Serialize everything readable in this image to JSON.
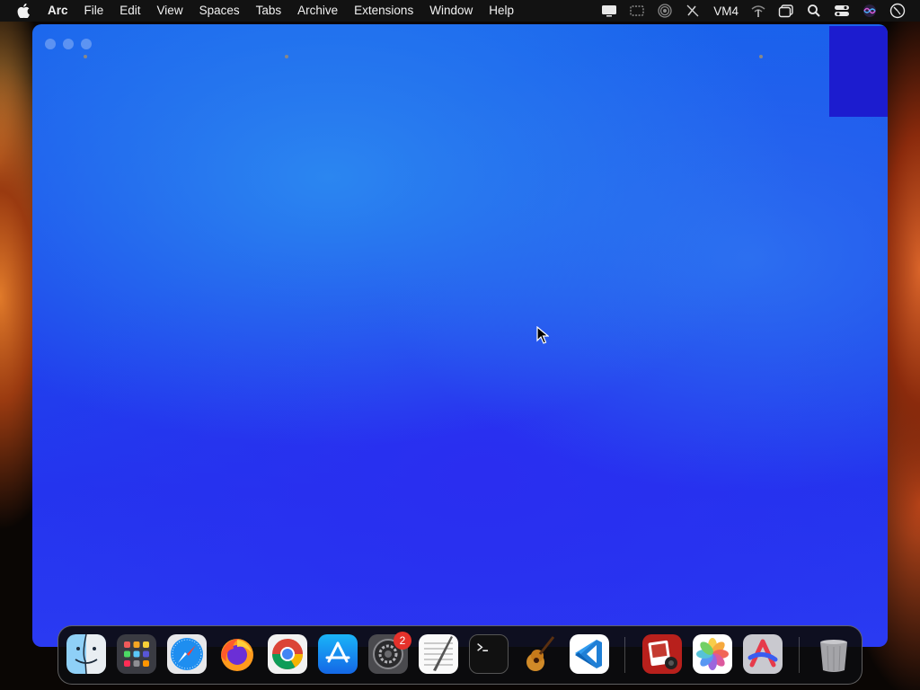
{
  "menubar": {
    "apple_icon": "apple-logo-icon",
    "app_name": "Arc",
    "items": [
      "File",
      "Edit",
      "View",
      "Spaces",
      "Tabs",
      "Archive",
      "Extensions",
      "Window",
      "Help"
    ],
    "status": {
      "display_icon": "display-icon",
      "screen_icon": "screen-mirroring-icon",
      "airdrop_icon": "broadcast-icon",
      "pen_icon": "pen-slash-icon",
      "vm_label": "VM4",
      "wifi_icon": "wifi-off-icon",
      "windows_icon": "windows-icon",
      "search_icon": "search-icon",
      "control_center_icon": "control-center-icon",
      "siri_icon": "siri-icon",
      "clock_icon": "clock-icon"
    }
  },
  "window": {
    "app": "Arc",
    "background_colors": [
      "#1a62ec",
      "#2434ee"
    ]
  },
  "dock": {
    "apps": [
      {
        "name": "Finder",
        "icon": "finder-icon",
        "running": true
      },
      {
        "name": "Launchpad",
        "icon": "launchpad-icon",
        "running": false
      },
      {
        "name": "Safari",
        "icon": "safari-icon",
        "running": false
      },
      {
        "name": "Firefox",
        "icon": "firefox-icon",
        "running": false
      },
      {
        "name": "Google Chrome",
        "icon": "chrome-icon",
        "running": true
      },
      {
        "name": "App Store",
        "icon": "app-store-icon",
        "running": false
      },
      {
        "name": "System Settings",
        "icon": "settings-icon",
        "running": false,
        "badge": "2"
      },
      {
        "name": "TextEdit",
        "icon": "textedit-icon",
        "running": false
      },
      {
        "name": "Terminal",
        "icon": "terminal-icon",
        "running": false
      },
      {
        "name": "GarageBand",
        "icon": "garageband-icon",
        "running": false
      },
      {
        "name": "Visual Studio Code",
        "icon": "vscode-icon",
        "running": false
      },
      {
        "name": "Photo Booth",
        "icon": "photo-booth-icon",
        "running": false
      },
      {
        "name": "Photos",
        "icon": "photos-icon",
        "running": false
      },
      {
        "name": "Arc",
        "icon": "arc-icon",
        "running": true
      },
      {
        "name": "Trash",
        "icon": "trash-icon",
        "running": false
      }
    ]
  }
}
